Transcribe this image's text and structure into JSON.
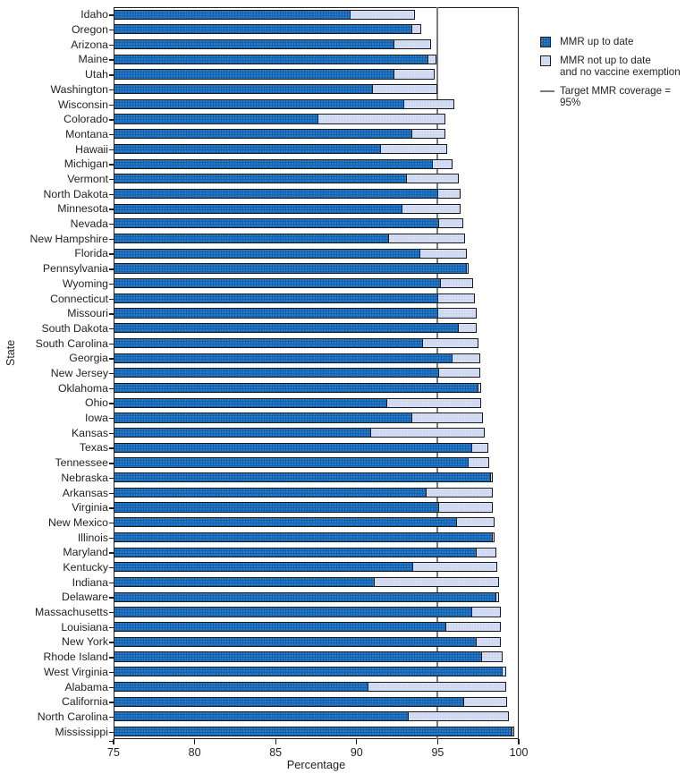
{
  "chart_data": {
    "type": "bar",
    "orientation": "horizontal",
    "stacked": true,
    "title": "",
    "xlabel": "Percentage",
    "ylabel": "State",
    "xlim": [
      75,
      100
    ],
    "xticks": [
      75,
      80,
      85,
      90,
      95,
      100
    ],
    "grid": false,
    "legend_position": "right",
    "reference_line": {
      "label": "Target MMR coverage = 95%",
      "value": 95,
      "color": "#7b7b7b"
    },
    "colors": {
      "up_to_date": "#0d62b4",
      "not_up_to_date": "#ccd6f0",
      "outline": "#1a1a1a"
    },
    "categories": [
      "Idaho",
      "Oregon",
      "Arizona",
      "Maine",
      "Utah",
      "Washington",
      "Wisconsin",
      "Colorado",
      "Montana",
      "Hawaii",
      "Michigan",
      "Vermont",
      "North Dakota",
      "Minnesota",
      "Nevada",
      "New Hampshire",
      "Florida",
      "Pennsylvania",
      "Wyoming",
      "Connecticut",
      "Missouri",
      "South Dakota",
      "South Carolina",
      "Georgia",
      "New Jersey",
      "Oklahoma",
      "Ohio",
      "Iowa",
      "Kansas",
      "Texas",
      "Tennessee",
      "Nebraska",
      "Arkansas",
      "Virginia",
      "New Mexico",
      "Illinois",
      "Maryland",
      "Kentucky",
      "Indiana",
      "Delaware",
      "Massachusetts",
      "Louisiana",
      "New York",
      "Rhode Island",
      "West Virginia",
      "Alabama",
      "California",
      "North Carolina",
      "Mississippi"
    ],
    "series": [
      {
        "name": "MMR up to date",
        "values": [
          89.5,
          93.3,
          92.2,
          94.3,
          92.2,
          90.9,
          92.8,
          87.5,
          93.3,
          91.4,
          94.6,
          93.0,
          94.9,
          92.7,
          95.0,
          91.9,
          93.8,
          96.7,
          95.1,
          94.9,
          94.9,
          96.2,
          94.0,
          95.8,
          95.0,
          97.4,
          91.8,
          93.3,
          90.8,
          97.0,
          96.8,
          98.2,
          94.2,
          95.0,
          96.1,
          98.3,
          97.3,
          93.4,
          91.0,
          98.5,
          97.0,
          95.4,
          97.3,
          97.6,
          98.9,
          90.6,
          96.5,
          93.1,
          99.5
        ]
      },
      {
        "name": "MMR not up to date and no vaccine exemption",
        "values": [
          4.1,
          0.7,
          2.4,
          0.6,
          2.6,
          4.1,
          3.2,
          8.0,
          2.2,
          4.2,
          1.3,
          3.3,
          1.5,
          3.7,
          1.6,
          4.8,
          3.0,
          0.2,
          2.1,
          2.4,
          2.5,
          1.2,
          3.5,
          1.8,
          2.6,
          0.3,
          5.9,
          4.5,
          7.1,
          1.1,
          1.4,
          0.2,
          4.2,
          3.4,
          2.4,
          0.2,
          1.3,
          5.3,
          7.8,
          0.3,
          1.9,
          3.5,
          1.6,
          1.4,
          0.3,
          8.6,
          2.8,
          6.3,
          0.2
        ]
      }
    ]
  },
  "legend": {
    "items": [
      {
        "type": "swatch-blue",
        "label": "MMR up to date"
      },
      {
        "type": "swatch-light",
        "label": "MMR not up to date",
        "label2": "and no vaccine exemption"
      },
      {
        "type": "line",
        "label": "Target MMR coverage = 95%"
      }
    ]
  }
}
